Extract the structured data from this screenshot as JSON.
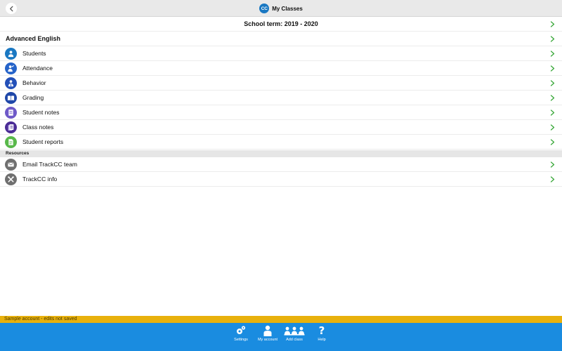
{
  "header": {
    "title": "My Classes",
    "logo_text": "CC",
    "back_icon": "chevron-left-icon"
  },
  "term": {
    "label": "School term: 2019 - 2020"
  },
  "class_section": {
    "title": "Advanced English"
  },
  "class_menu": [
    {
      "label": "Students",
      "icon": "student-icon",
      "color": "#1a78c2"
    },
    {
      "label": "Attendance",
      "icon": "attendance-icon",
      "color": "#2563c9"
    },
    {
      "label": "Behavior",
      "icon": "behavior-icon",
      "color": "#2350b8"
    },
    {
      "label": "Grading",
      "icon": "book-icon",
      "color": "#1f47a8"
    },
    {
      "label": "Student notes",
      "icon": "notes-icon",
      "color": "#6e59c8"
    },
    {
      "label": "Class notes",
      "icon": "class-notes-icon",
      "color": "#4b2c96"
    },
    {
      "label": "Student reports",
      "icon": "report-icon",
      "color": "#58b84a"
    }
  ],
  "resources": {
    "title": "Resources",
    "items": [
      {
        "label": "Email TrackCC team",
        "icon": "email-icon",
        "color": "#6f6f6f"
      },
      {
        "label": "TrackCC info",
        "icon": "tools-icon",
        "color": "#6f6f6f"
      }
    ]
  },
  "warning": {
    "text": "Sample account - edits not saved"
  },
  "tabbar": {
    "items": [
      {
        "label": "Settings",
        "icon": "settings-icon"
      },
      {
        "label": "My account",
        "icon": "account-icon"
      },
      {
        "label": "Add class",
        "icon": "add-class-icon"
      },
      {
        "label": "Help",
        "icon": "help-icon"
      }
    ]
  },
  "colors": {
    "accent": "#1a8ce0",
    "chevron": "#3aa83a",
    "warning": "#e8b10c"
  }
}
